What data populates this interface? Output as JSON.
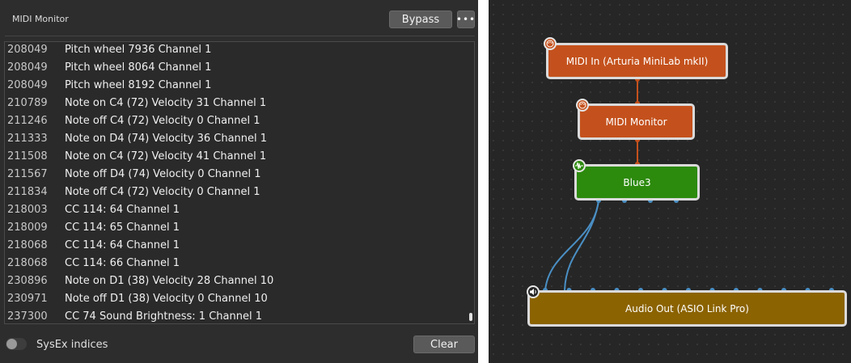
{
  "monitor": {
    "title": "MIDI Monitor",
    "bypass_label": "Bypass",
    "more_label": "•••",
    "rows": [
      {
        "ts": "208049",
        "msg": "Pitch wheel 7936 Channel 1"
      },
      {
        "ts": "208049",
        "msg": "Pitch wheel 8064 Channel 1"
      },
      {
        "ts": "208049",
        "msg": "Pitch wheel 8192 Channel 1"
      },
      {
        "ts": "210789",
        "msg": "Note on C4 (72) Velocity 31 Channel 1"
      },
      {
        "ts": "211246",
        "msg": "Note off C4 (72) Velocity 0 Channel 1"
      },
      {
        "ts": "211333",
        "msg": "Note on D4 (74) Velocity 36 Channel 1"
      },
      {
        "ts": "211508",
        "msg": "Note on C4 (72) Velocity 41 Channel 1"
      },
      {
        "ts": "211567",
        "msg": "Note off D4 (74) Velocity 0 Channel 1"
      },
      {
        "ts": "211834",
        "msg": "Note off C4 (72) Velocity 0 Channel 1"
      },
      {
        "ts": "218003",
        "msg": "CC 114: 64 Channel 1"
      },
      {
        "ts": "218009",
        "msg": "CC 114: 65 Channel 1"
      },
      {
        "ts": "218068",
        "msg": "CC 114: 64 Channel 1"
      },
      {
        "ts": "218068",
        "msg": "CC 114: 66 Channel 1"
      },
      {
        "ts": "230896",
        "msg": "Note on D1 (38) Velocity 28 Channel 10"
      },
      {
        "ts": "230971",
        "msg": "Note off D1 (38) Velocity 0 Channel 10"
      },
      {
        "ts": "237300",
        "msg": "CC 74 Sound Brightness: 1 Channel 1"
      }
    ],
    "sysex_label": "SysEx indices",
    "sysex_enabled": false,
    "clear_label": "Clear"
  },
  "graph": {
    "nodes": {
      "midi_in": {
        "label": "MIDI In (Arturia MiniLab mkII)",
        "icon": "midi-port-icon"
      },
      "monitor": {
        "label": "MIDI Monitor",
        "icon": "midi-port-icon"
      },
      "blue3": {
        "label": "Blue3",
        "icon": "waveform-icon"
      },
      "audio_out": {
        "label": "Audio Out (ASIO Link Pro)",
        "icon": "speaker-icon"
      }
    },
    "colors": {
      "midi_node": "#c4511d",
      "instrument_node": "#2c8a0d",
      "audio_node": "#8b6300",
      "midi_wire": "#c4511d",
      "audio_wire": "#4a8fc4"
    }
  }
}
